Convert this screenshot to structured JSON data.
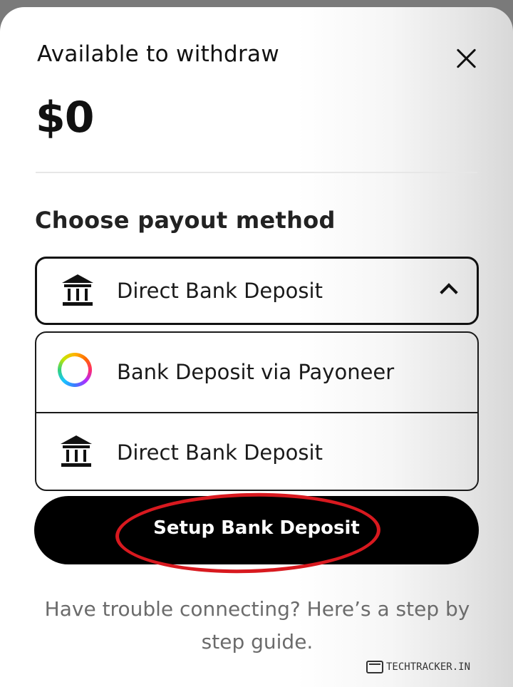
{
  "withdraw": {
    "title": "Available to withdraw",
    "amount": "$0"
  },
  "payout": {
    "section_title": "Choose payout method",
    "selected": "Direct Bank Deposit",
    "options": [
      {
        "label": "Bank Deposit via Payoneer",
        "icon": "payoneer-ring-icon"
      },
      {
        "label": "Direct Bank Deposit",
        "icon": "bank-icon"
      }
    ]
  },
  "cta": {
    "label": "Setup Bank Deposit"
  },
  "help": {
    "text": "Have trouble connecting? Here’s a step by step guide."
  },
  "watermark": {
    "text": "TECHTRACKER.IN"
  },
  "colors": {
    "annotation": "#d8191f",
    "primary": "#000000"
  },
  "icons": {
    "close": "close-icon",
    "chevron": "chevron-up-icon",
    "bank": "bank-icon",
    "payoneer": "payoneer-ring-icon"
  }
}
